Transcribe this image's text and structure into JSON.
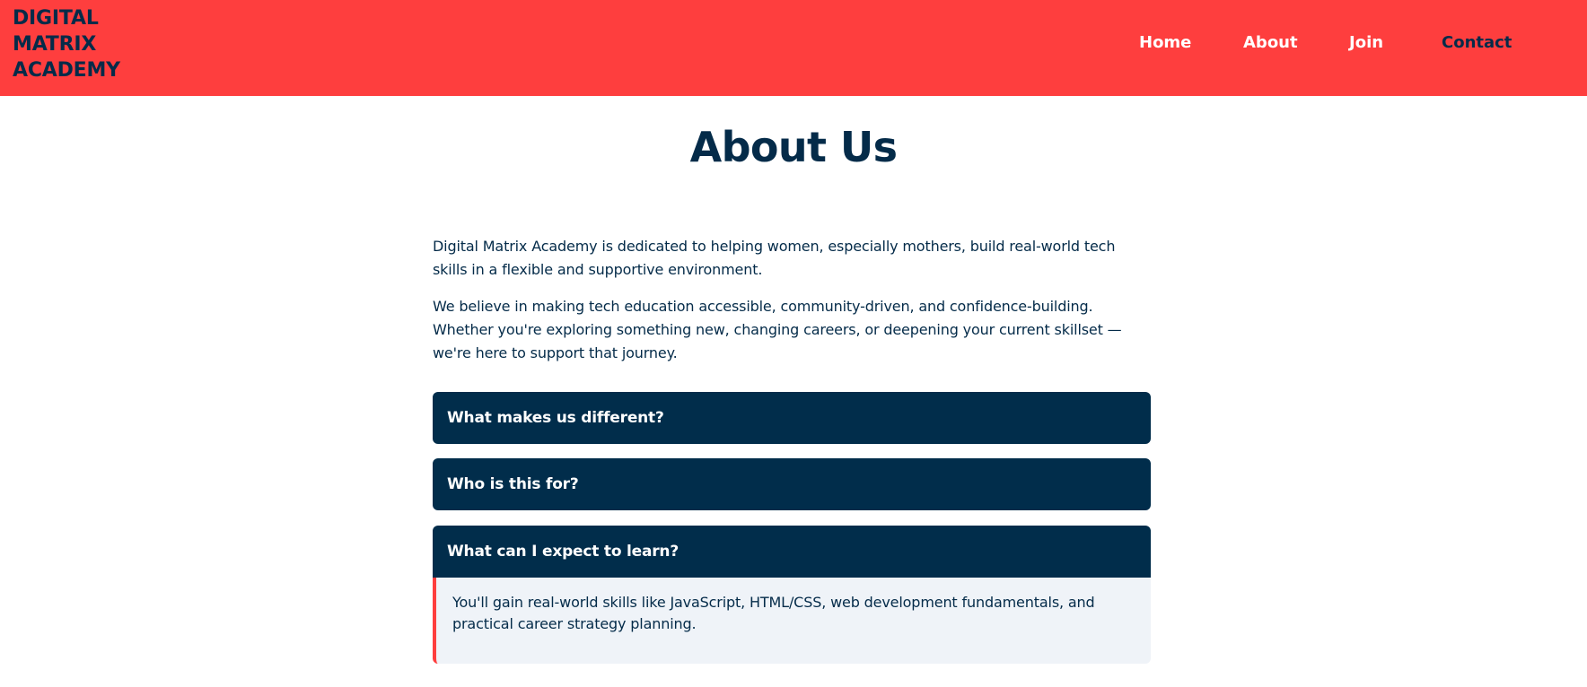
{
  "header": {
    "logo_lines": [
      "DIGITAL",
      "MATRIX",
      "ACADEMY"
    ],
    "nav": [
      {
        "label": "Home",
        "color": "#ffffff"
      },
      {
        "label": "About",
        "color": "#ffffff"
      },
      {
        "label": "Join",
        "color": "#ffffff"
      },
      {
        "label": "Contact",
        "color": "#042b49"
      }
    ],
    "background_color": "#fe3e3e"
  },
  "main": {
    "title": "About Us",
    "paragraphs": [
      "Digital Matrix Academy is dedicated to helping women, especially mothers, build real-world tech skills in a flexible and supportive environment.",
      "We believe in making tech education accessible, community-driven, and confidence-building. Whether you're exploring something new, changing careers, or deepening your current skillset — we're here to support that journey."
    ],
    "faq": [
      {
        "question": "What makes us different?",
        "expanded": false
      },
      {
        "question": "Who is this for?",
        "expanded": false
      },
      {
        "question": "What can I expect to learn?",
        "expanded": true,
        "answer": "You'll gain real-world skills like JavaScript, HTML/CSS, web development fundamentals, and practical career strategy planning."
      }
    ]
  },
  "colors": {
    "accent": "#fe3e3e",
    "navy": "#042b49",
    "answer_bg": "#eff3f8"
  }
}
